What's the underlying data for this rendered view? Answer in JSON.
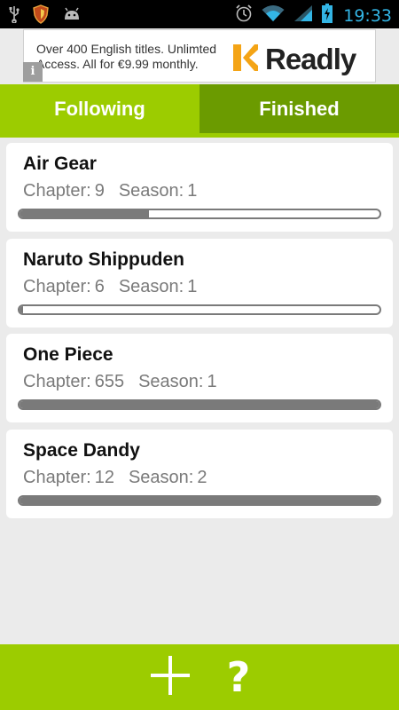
{
  "status_bar": {
    "time": "19:33",
    "left_icons": [
      "usb-icon",
      "shield-app-icon",
      "android-icon"
    ],
    "right_icons": [
      "alarm-icon",
      "wifi-icon",
      "signal-icon",
      "battery-charging-icon"
    ]
  },
  "ad": {
    "text": "Over 400 English titles. Unlimted Access. All for €9.99 monthly.",
    "brand": "Readly",
    "info_glyph": "i"
  },
  "tabs": [
    {
      "label": "Following",
      "selected": true
    },
    {
      "label": "Finished",
      "selected": false
    }
  ],
  "series": [
    {
      "title": "Air Gear",
      "chapter_label": "Chapter:",
      "chapter": "9",
      "season_label": "Season:",
      "season": "1",
      "progress": 0.36
    },
    {
      "title": "Naruto Shippuden",
      "chapter_label": "Chapter:",
      "chapter": "6",
      "season_label": "Season:",
      "season": "1",
      "progress": 0.01
    },
    {
      "title": "One Piece",
      "chapter_label": "Chapter:",
      "chapter": "655",
      "season_label": "Season:",
      "season": "1",
      "progress": 1.0
    },
    {
      "title": "Space Dandy",
      "chapter_label": "Chapter:",
      "chapter": "12",
      "season_label": "Season:",
      "season": "2",
      "progress": 1.0
    }
  ],
  "bottom_bar": {
    "add_icon": "plus-icon",
    "help_glyph": "?"
  },
  "colors": {
    "accent": "#9ccc00",
    "accent_dark": "#6b9b00",
    "time": "#33b5e5"
  }
}
